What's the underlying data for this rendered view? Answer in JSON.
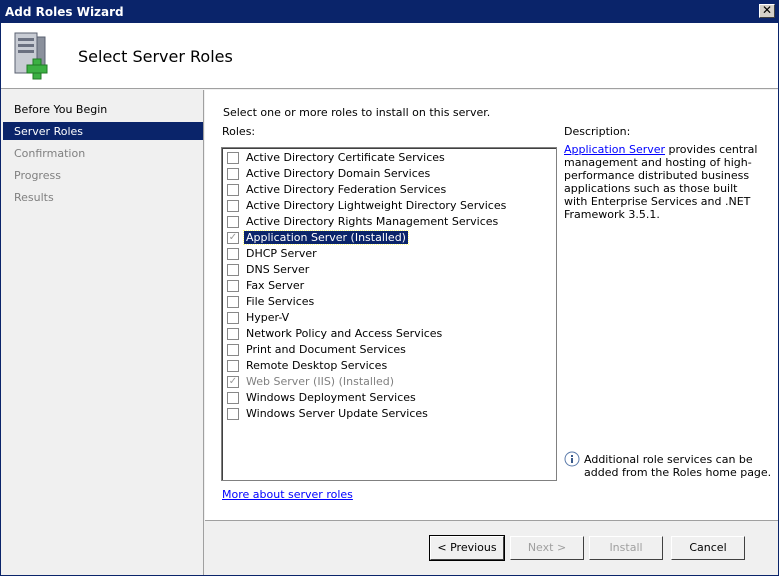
{
  "window": {
    "title": "Add Roles Wizard"
  },
  "header": {
    "title": "Select Server Roles"
  },
  "nav": {
    "items": [
      {
        "label": "Before You Begin"
      },
      {
        "label": "Server Roles"
      },
      {
        "label": "Confirmation"
      },
      {
        "label": "Progress"
      },
      {
        "label": "Results"
      }
    ]
  },
  "main": {
    "instruction": "Select one or more roles to install on this server.",
    "roles_label": "Roles:",
    "roles": [
      {
        "label": "Active Directory Certificate Services",
        "checked": false
      },
      {
        "label": "Active Directory Domain Services",
        "checked": false
      },
      {
        "label": "Active Directory Federation Services",
        "checked": false
      },
      {
        "label": "Active Directory Lightweight Directory Services",
        "checked": false
      },
      {
        "label": "Active Directory Rights Management Services",
        "checked": false
      },
      {
        "label": "Application Server  (Installed)",
        "checked": true
      },
      {
        "label": "DHCP Server",
        "checked": false
      },
      {
        "label": "DNS Server",
        "checked": false
      },
      {
        "label": "Fax Server",
        "checked": false
      },
      {
        "label": "File Services",
        "checked": false
      },
      {
        "label": "Hyper-V",
        "checked": false
      },
      {
        "label": "Network Policy and Access Services",
        "checked": false
      },
      {
        "label": "Print and Document Services",
        "checked": false
      },
      {
        "label": "Remote Desktop Services",
        "checked": false
      },
      {
        "label": "Web Server (IIS)  (Installed)",
        "checked": true
      },
      {
        "label": "Windows Deployment Services",
        "checked": false
      },
      {
        "label": "Windows Server Update Services",
        "checked": false
      }
    ],
    "description_label": "Description:",
    "description_link": "Application Server",
    "description_body": " provides central management and hosting of high-performance distributed business applications such as those built with Enterprise Services and .NET Framework 3.5.1.",
    "info_text": "Additional role services can be added from the Roles home page.",
    "more_link": "More about server roles"
  },
  "footer": {
    "previous": "< Previous",
    "next": "Next >",
    "install": "Install",
    "cancel": "Cancel"
  },
  "colors": {
    "title_bar": "#0a246a",
    "selection": "#0a246a",
    "link": "#0000ff"
  }
}
